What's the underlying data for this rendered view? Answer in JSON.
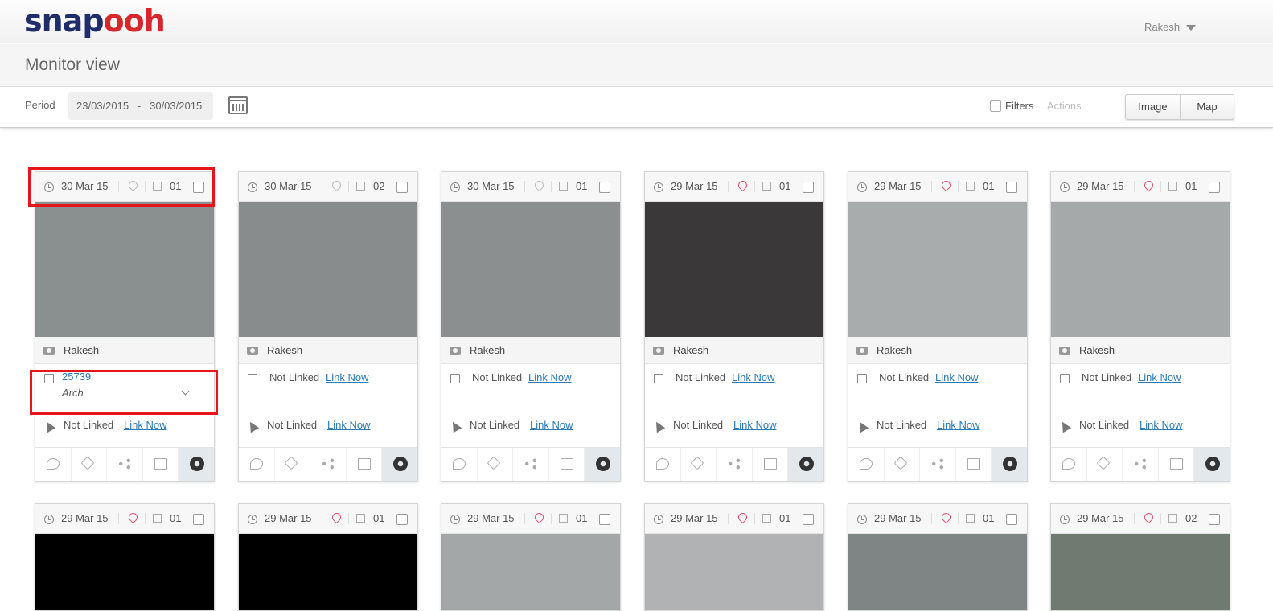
{
  "app": {
    "logo_a": "snap",
    "logo_b": "ooh",
    "user": "Rakesh"
  },
  "page": {
    "title": "Monitor view"
  },
  "toolbar": {
    "period_label": "Period",
    "date_from": "23/03/2015",
    "date_sep": "-",
    "date_to": "30/03/2015",
    "filters_label": "Filters",
    "actions_label": "Actions",
    "image_btn": "Image",
    "map_btn": "Map"
  },
  "cards": [
    {
      "date": "30 Mar 15",
      "count": "01",
      "pin": "grey",
      "user": "Rakesh",
      "image_color": "#8a8f90",
      "linked_id": "25739",
      "linked_name": "Arch",
      "campaign_status": "Not Linked",
      "link_label": "Link Now"
    },
    {
      "date": "30 Mar 15",
      "count": "02",
      "pin": "grey",
      "user": "Rakesh",
      "image_color": "#888c8d",
      "line1": "Not Linked",
      "link1": "Link Now",
      "line2": "Not Linked",
      "link2": "Link Now"
    },
    {
      "date": "30 Mar 15",
      "count": "01",
      "pin": "grey",
      "user": "Rakesh",
      "image_color": "#8b8f90",
      "line1": "Not Linked",
      "link1": "Link Now",
      "line2": "Not Linked",
      "link2": "Link Now"
    },
    {
      "date": "29 Mar 15",
      "count": "01",
      "pin": "red",
      "user": "Rakesh",
      "image_color": "#3a3838",
      "line1": "Not Linked",
      "link1": "Link Now",
      "line2": "Not Linked",
      "link2": "Link Now"
    },
    {
      "date": "29 Mar 15",
      "count": "01",
      "pin": "red",
      "user": "Rakesh",
      "image_color": "#a9acad",
      "line1": "Not Linked",
      "link1": "Link Now",
      "line2": "Not Linked",
      "link2": "Link Now"
    },
    {
      "date": "29 Mar 15",
      "count": "01",
      "pin": "red",
      "user": "Rakesh",
      "image_color": "#a6a9aa",
      "line1": "Not Linked",
      "link1": "Link Now",
      "line2": "Not Linked",
      "link2": "Link Now"
    }
  ],
  "cards_row2": [
    {
      "date": "29 Mar 15",
      "count": "01",
      "pin": "red",
      "image_color": "#000000"
    },
    {
      "date": "29 Mar 15",
      "count": "01",
      "pin": "red",
      "image_color": "#000000"
    },
    {
      "date": "29 Mar 15",
      "count": "01",
      "pin": "red",
      "image_color": "#a4a7a8"
    },
    {
      "date": "29 Mar 15",
      "count": "01",
      "pin": "red",
      "image_color": "#b0b2b3"
    },
    {
      "date": "29 Mar 15",
      "count": "01",
      "pin": "red",
      "image_color": "#7f8484"
    },
    {
      "date": "29 Mar 15",
      "count": "02",
      "pin": "red",
      "image_color": "#6f7a70"
    }
  ]
}
